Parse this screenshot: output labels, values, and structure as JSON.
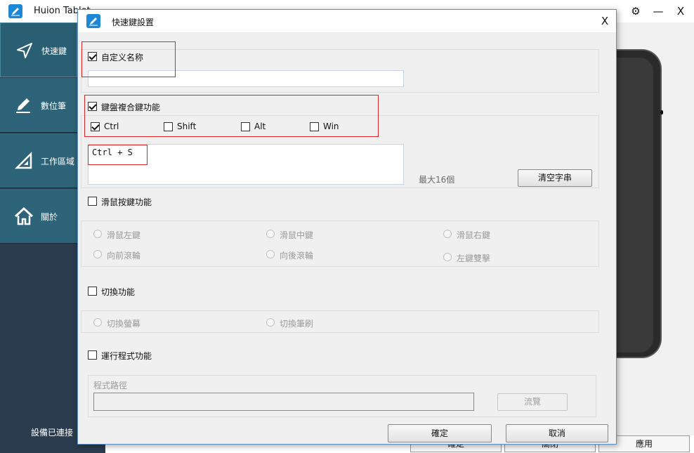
{
  "main_window": {
    "title": "Huion Tablet",
    "controls": {
      "settings": "⚙",
      "minimize": "—",
      "close": "X"
    }
  },
  "sidebar": {
    "items": [
      {
        "label": "快速鍵",
        "icon": "send-arrow-icon",
        "active": true
      },
      {
        "label": "數位筆",
        "icon": "pen-icon",
        "active": false
      },
      {
        "label": "工作區域",
        "icon": "set-square-icon",
        "active": false
      },
      {
        "label": "關於",
        "icon": "home-icon",
        "active": false
      }
    ],
    "status": "設備已連接"
  },
  "main_buttons": {
    "confirm": "確定",
    "close": "關閉",
    "apply": "應用"
  },
  "dialog": {
    "title": "快速鍵設置",
    "close": "X",
    "custom_name": {
      "label": "自定义名称",
      "checked": true,
      "value": ""
    },
    "keyboard_combo": {
      "label": "鍵盤複合鍵功能",
      "checked": true,
      "modifiers": [
        {
          "label": "Ctrl",
          "checked": true
        },
        {
          "label": "Shift",
          "checked": false
        },
        {
          "label": "Alt",
          "checked": false
        },
        {
          "label": "Win",
          "checked": false
        }
      ],
      "value": "Ctrl + S",
      "max_hint": "最大16個",
      "clear_button": "清空字串"
    },
    "mouse": {
      "label": "滑鼠按鍵功能",
      "checked": false,
      "options": [
        "滑鼠左鍵",
        "滑鼠中鍵",
        "滑鼠右鍵",
        "向前滾輪",
        "向後滾輪",
        "左鍵雙擊"
      ]
    },
    "switch": {
      "label": "切換功能",
      "checked": false,
      "options": [
        "切換螢幕",
        "切換筆刷"
      ]
    },
    "run_program": {
      "label": "運行程式功能",
      "checked": false,
      "path_label": "程式路徑",
      "path_value": "",
      "browse_button": "流覽"
    },
    "ok_button": "確定",
    "cancel_button": "取消"
  },
  "colors": {
    "sidebar_bg": "#2b3c4e",
    "sidebar_item": "#2e6479",
    "highlight_box": "#d9262b",
    "accent": "#1e88d8"
  }
}
